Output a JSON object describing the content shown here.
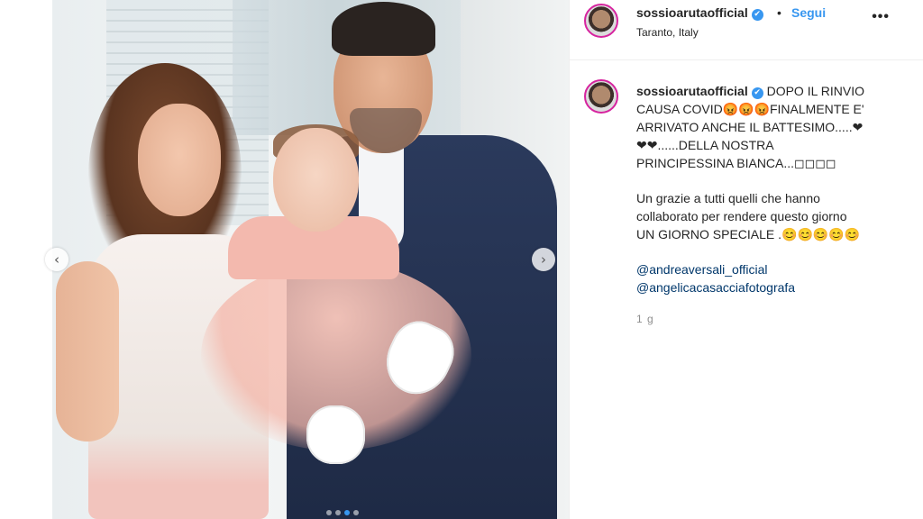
{
  "post": {
    "username": "sossioarutaofficial",
    "verified_glyph": "✔",
    "follow_separator": "•",
    "follow_label": "Segui",
    "location": "Taranto, Italy",
    "more_label": "•••",
    "caption_lines": [
      "DOPO IL RINVIO",
      "CAUSA COVID😡😡😡FINALMENTE E'",
      "ARRIVATO ANCHE IL BATTESIMO.....❤",
      "❤❤......DELLA NOSTRA",
      "PRINCIPESSINA BIANCA...◻◻◻◻"
    ],
    "caption_paragraph2": [
      "Un grazie a tutti quelli che hanno",
      "collaborato per rendere questo giorno",
      "UN GIORNO SPECIALE .😊😊😊😊😊"
    ],
    "mentions": [
      "@andreaversali_official",
      "@angelicacasacciafotografa"
    ],
    "time_ago": "1 g"
  },
  "carousel": {
    "prev_glyph": "‹",
    "next_glyph": "›",
    "dot_count": 4,
    "active_dot": 2
  },
  "icons": [
    "verified-badge-icon",
    "more-options-icon",
    "chevron-left-icon",
    "chevron-right-icon"
  ],
  "colors": {
    "link": "#3897f0",
    "mention": "#00376b",
    "text": "#262626",
    "muted": "#8e8e8e"
  }
}
